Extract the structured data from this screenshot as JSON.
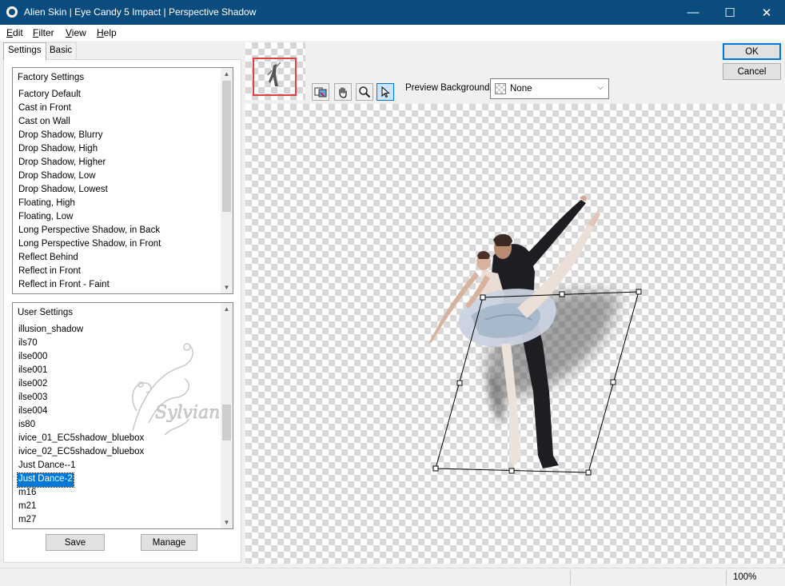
{
  "window": {
    "title": "Alien Skin | Eye Candy 5 Impact | Perspective Shadow",
    "minimize_glyph": "—",
    "maximize_glyph": "☐",
    "close_glyph": "✕"
  },
  "menu": [
    {
      "key": "E",
      "rest": "dit"
    },
    {
      "key": "F",
      "rest": "ilter"
    },
    {
      "key": "V",
      "rest": "iew"
    },
    {
      "key": "H",
      "rest": "elp"
    }
  ],
  "tabs": [
    "Settings",
    "Basic"
  ],
  "factory_settings": {
    "header": "Factory Settings",
    "items": [
      "Factory Default",
      "Cast in Front",
      "Cast on Wall",
      "Drop Shadow, Blurry",
      "Drop Shadow, High",
      "Drop Shadow, Higher",
      "Drop Shadow, Low",
      "Drop Shadow, Lowest",
      "Floating, High",
      "Floating, Low",
      "Long Perspective Shadow, in Back",
      "Long Perspective Shadow, in Front",
      "Reflect Behind",
      "Reflect in Front",
      "Reflect in Front - Faint"
    ]
  },
  "user_settings": {
    "header": "User Settings",
    "items": [
      "illusion_shadow",
      "ils70",
      "ilse000",
      "ilse001",
      "ilse002",
      "ilse003",
      "ilse004",
      "is80",
      "ivice_01_EC5shadow_bluebox",
      "ivice_02_EC5shadow_bluebox",
      "Just Dance--1",
      "Just Dance-2",
      "m16",
      "m21",
      "m27"
    ],
    "selected": "Just Dance-2"
  },
  "watermark": "Sylviane",
  "buttons": {
    "save": "Save",
    "manage": "Manage",
    "ok": "OK",
    "cancel": "Cancel"
  },
  "toolbar": {
    "tools": [
      "preview-toggle-icon",
      "hand-icon",
      "zoom-icon",
      "arrow-pointer-icon"
    ],
    "active_tool": "arrow-pointer-icon"
  },
  "preview_background": {
    "label": "Preview Background:",
    "value": "None"
  },
  "status": {
    "zoom": "100%"
  },
  "colors": {
    "titlebar": "#0b4c7e",
    "selection": "#0078d7",
    "thumbnail_frame": "#e04040"
  }
}
